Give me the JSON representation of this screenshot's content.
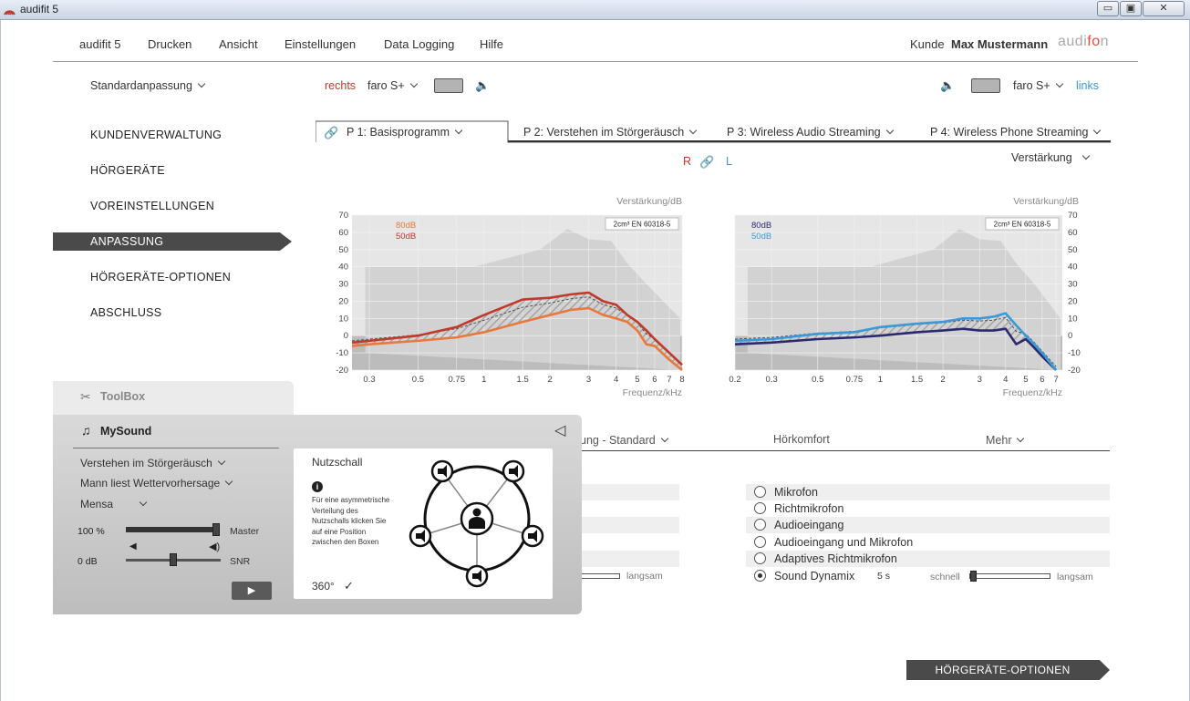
{
  "window": {
    "title": "audifit 5",
    "minimize": "▭",
    "restore": "▣",
    "close": "✕"
  },
  "menu": {
    "items": [
      "audifit 5",
      "Drucken",
      "Ansicht",
      "Einstellungen",
      "Data Logging",
      "Hilfe"
    ],
    "kunde_label": "Kunde",
    "kunde_name": "Max Mustermann",
    "brand_left": "audi",
    "brand_mid": "fo",
    "brand_right": "n"
  },
  "toolbar": {
    "fitting_mode": "Standardanpassung",
    "right_label": "rechts",
    "left_label": "links",
    "device_right": "faro S+",
    "device_left": "faro S+"
  },
  "nav": {
    "items": [
      "KUNDENVERWALTUNG",
      "HÖRGERÄTE",
      "VOREINSTELLUNGEN",
      "ANPASSUNG",
      "HÖRGERÄTE-OPTIONEN",
      "ABSCHLUSS"
    ],
    "active_index": 3
  },
  "programs": {
    "tabs": [
      "P 1: Basisprogramm",
      "P 2: Verstehen im Störgeräusch",
      "P 3: Wireless Audio Streaming",
      "P 4: Wireless Phone Streaming"
    ],
    "active_index": 0
  },
  "link_row": {
    "r": "R",
    "l": "L",
    "view_select": "Verstärkung"
  },
  "colors": {
    "right": "#c0392b",
    "left": "#3a9ad9",
    "dark": "#4a4a4a"
  },
  "chart_data": [
    {
      "type": "line",
      "side": "right",
      "title": "",
      "ylabel": "Verstärkung/dB",
      "xlabel": "Frequenz/kHz",
      "standard": "2cm³ EN 60318-5",
      "yticks": [
        "70",
        "60",
        "50",
        "40",
        "30",
        "20",
        "10",
        "0",
        "-10",
        "-20"
      ],
      "xticks": [
        "0.3",
        "0.5",
        "0.75",
        "1",
        "1.5",
        "2",
        "3",
        "4",
        "5",
        "6",
        "7",
        "8"
      ],
      "ylim": [
        -20,
        70
      ],
      "xlim": [
        0.25,
        8
      ],
      "x_log": true,
      "series": [
        {
          "name": "80dB",
          "color": "#e8793a",
          "x": [
            0.25,
            0.3,
            0.5,
            0.75,
            1,
            1.5,
            2,
            2.5,
            3,
            3.5,
            4,
            4.5,
            5,
            5.5,
            6,
            7,
            8
          ],
          "y": [
            -6,
            -5,
            -3,
            -1,
            2,
            8,
            12,
            15,
            16,
            12,
            10,
            8,
            3,
            -5,
            -6,
            -14,
            -20
          ]
        },
        {
          "name": "50dB",
          "color": "#c0392b",
          "x": [
            0.25,
            0.3,
            0.5,
            0.75,
            1,
            1.5,
            2,
            2.5,
            3,
            3.5,
            4,
            4.5,
            5,
            5.5,
            6,
            7,
            8
          ],
          "y": [
            -4,
            -3,
            0,
            5,
            12,
            21,
            22,
            24,
            25,
            20,
            18,
            12,
            8,
            3,
            -2,
            -10,
            -17
          ]
        }
      ]
    },
    {
      "type": "line",
      "side": "left",
      "title": "",
      "ylabel": "Verstärkung/dB",
      "xlabel": "Frequenz/kHz",
      "standard": "2cm³ EN 60318-5",
      "yticks": [
        "70",
        "60",
        "50",
        "40",
        "30",
        "20",
        "10",
        "0",
        "-10",
        "-20"
      ],
      "xticks": [
        "0.2",
        "0.3",
        "0.5",
        "0.75",
        "1",
        "1.5",
        "2",
        "3",
        "4",
        "5",
        "6",
        "7"
      ],
      "ylim": [
        -20,
        70
      ],
      "xlim": [
        0.2,
        7.5
      ],
      "x_log": true,
      "series": [
        {
          "name": "80dB",
          "color": "#2c2a6e",
          "x": [
            0.2,
            0.3,
            0.5,
            0.75,
            1,
            1.5,
            2,
            2.5,
            3,
            3.5,
            4,
            4.5,
            5,
            5.5,
            6,
            7
          ],
          "y": [
            -5,
            -4,
            -2,
            -1,
            0,
            2,
            3,
            4,
            3,
            3,
            4,
            -5,
            -2,
            -7,
            -12,
            -20
          ]
        },
        {
          "name": "50dB",
          "color": "#3a9ad9",
          "x": [
            0.2,
            0.3,
            0.5,
            0.75,
            1,
            1.5,
            2,
            2.5,
            3,
            3.5,
            4,
            4.5,
            5,
            5.5,
            6,
            7
          ],
          "y": [
            -3,
            -2,
            1,
            2,
            5,
            7,
            8,
            10,
            10,
            11,
            13,
            6,
            0,
            -5,
            -10,
            -20
          ]
        }
      ]
    }
  ],
  "sections": {
    "hidden_tab": "ung - Standard",
    "hoerkomfort": "Hörkomfort",
    "mehr": "Mehr"
  },
  "options": {
    "items": [
      "Mikrofon",
      "Richtmikrofon",
      "Audioeingang",
      "Audioeingang und Mikrofon",
      "Adaptives Richtmikrofon",
      "Sound Dynamix"
    ],
    "selected_index": 5,
    "dynamix_value": "5 s",
    "fast_label": "schnell",
    "slow_label": "langsam",
    "slow_label_left": "langsam"
  },
  "toolbox": {
    "title": "ToolBox"
  },
  "mysound": {
    "title": "MySound",
    "situation": "Verstehen im Störgeräusch",
    "scenario": "Mann liest Wettervorhersage",
    "environment": "Mensa",
    "master_value": "100 %",
    "master_label": "Master",
    "snr_value": "0 dB",
    "snr_label": "SNR",
    "play": "▶",
    "collapse": "◁"
  },
  "nutzschall": {
    "title": "Nutzschall",
    "info": "Für eine asymmetrische Verteilung des Nutzschalls klicken Sie auf eine Position zwischen den Boxen",
    "angle": "360°",
    "check": "✓"
  },
  "cta": {
    "label": "HÖRGERÄTE-OPTIONEN"
  }
}
